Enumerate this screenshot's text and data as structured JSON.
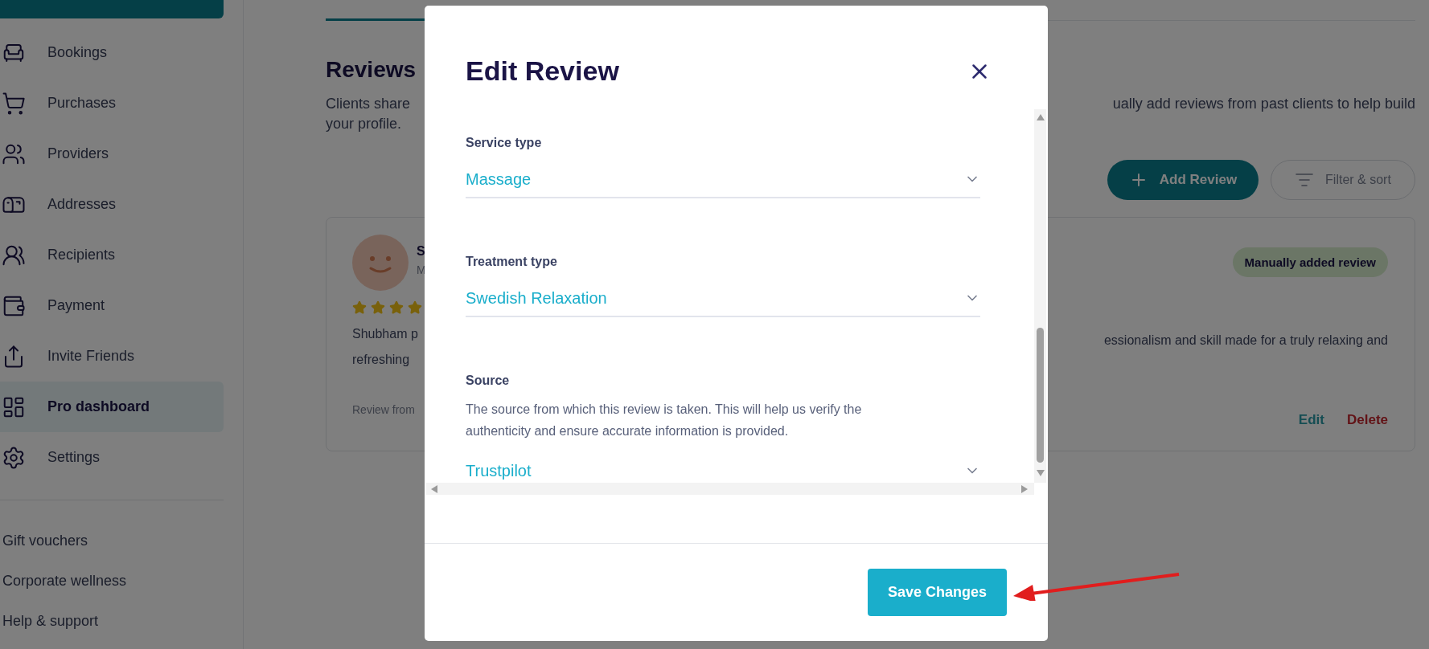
{
  "sidebar": {
    "items": [
      {
        "label": "Bookings",
        "selected": false
      },
      {
        "label": "Purchases",
        "selected": false
      },
      {
        "label": "Providers",
        "selected": false
      },
      {
        "label": "Addresses",
        "selected": false
      },
      {
        "label": "Recipients",
        "selected": false
      },
      {
        "label": "Payment",
        "selected": false
      },
      {
        "label": "Invite Friends",
        "selected": false
      },
      {
        "label": "Pro dashboard",
        "selected": true
      },
      {
        "label": "Settings",
        "selected": false
      }
    ],
    "links": [
      "Gift vouchers",
      "Corporate wellness",
      "Help & support"
    ]
  },
  "page": {
    "title": "Reviews",
    "description_left": [
      "Clients share",
      "your profile."
    ],
    "description_right": "ually add reviews from past clients to help build",
    "add_button": "Add Review",
    "filter_button": "Filter & sort"
  },
  "review_card": {
    "name": "S",
    "meta": "M",
    "stars": 4,
    "text_left": [
      "Shubham p",
      "refreshing"
    ],
    "text_right": "essionalism and skill made for a truly relaxing and",
    "footer_left": "Review from",
    "badge": "Manually added review",
    "edit": "Edit",
    "delete": "Delete"
  },
  "modal": {
    "title": "Edit Review",
    "fields": [
      {
        "label": "Service type",
        "value": "Massage"
      },
      {
        "label": "Treatment type",
        "value": "Swedish Relaxation"
      },
      {
        "label": "Source",
        "hint": "The source from which this review is taken. This will help us verify the authenticity and ensure accurate information is provided.",
        "value": "Trustpilot"
      }
    ],
    "save_button": "Save Changes"
  }
}
